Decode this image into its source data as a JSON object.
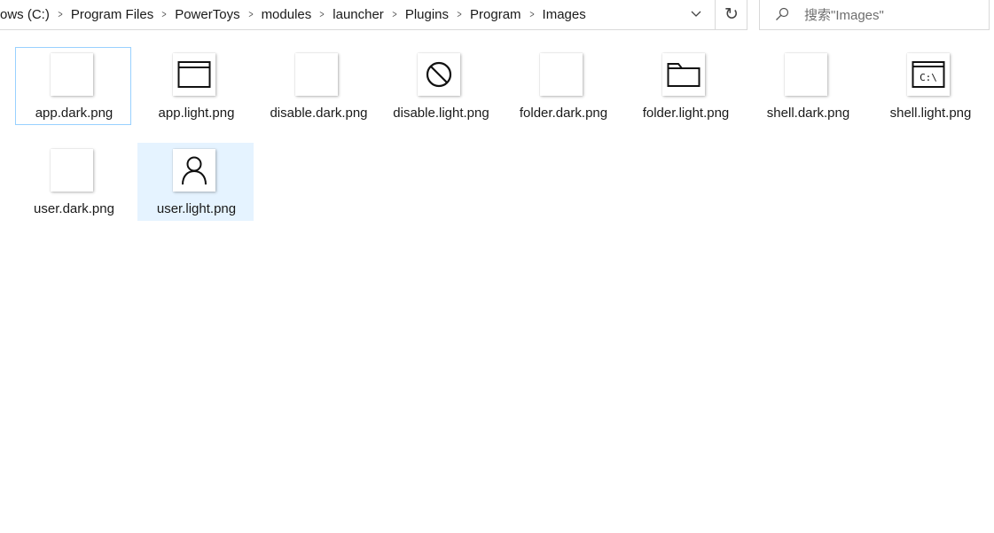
{
  "address": {
    "breadcrumbs": [
      "ows (C:)",
      "Program Files",
      "PowerToys",
      "modules",
      "launcher",
      "Plugins",
      "Program",
      "Images"
    ],
    "separator_icon": "chevron-right-icon",
    "dropdown_icon": "chevron-down-icon",
    "refresh_icon": "refresh-icon",
    "refresh_glyph": "↻"
  },
  "search": {
    "placeholder": "搜索\"Images\"",
    "icon": "search-icon"
  },
  "files": [
    {
      "name": "app.dark.png",
      "icon": "blank-icon",
      "state": "focused"
    },
    {
      "name": "app.light.png",
      "icon": "app-window-icon",
      "state": "normal"
    },
    {
      "name": "disable.dark.png",
      "icon": "blank-icon",
      "state": "normal"
    },
    {
      "name": "disable.light.png",
      "icon": "disable-icon",
      "state": "normal"
    },
    {
      "name": "folder.dark.png",
      "icon": "blank-icon",
      "state": "normal"
    },
    {
      "name": "folder.light.png",
      "icon": "folder-icon",
      "state": "normal"
    },
    {
      "name": "shell.dark.png",
      "icon": "blank-icon",
      "state": "normal"
    },
    {
      "name": "shell.light.png",
      "icon": "shell-icon",
      "state": "normal"
    },
    {
      "name": "user.dark.png",
      "icon": "blank-icon",
      "state": "normal"
    },
    {
      "name": "user.light.png",
      "icon": "user-icon",
      "state": "selected"
    }
  ],
  "shell_icon_text": "C:\\",
  "colors": {
    "selection_bg": "#e5f3ff",
    "focus_border": "#99d1ff",
    "border": "#d9d9d9"
  }
}
